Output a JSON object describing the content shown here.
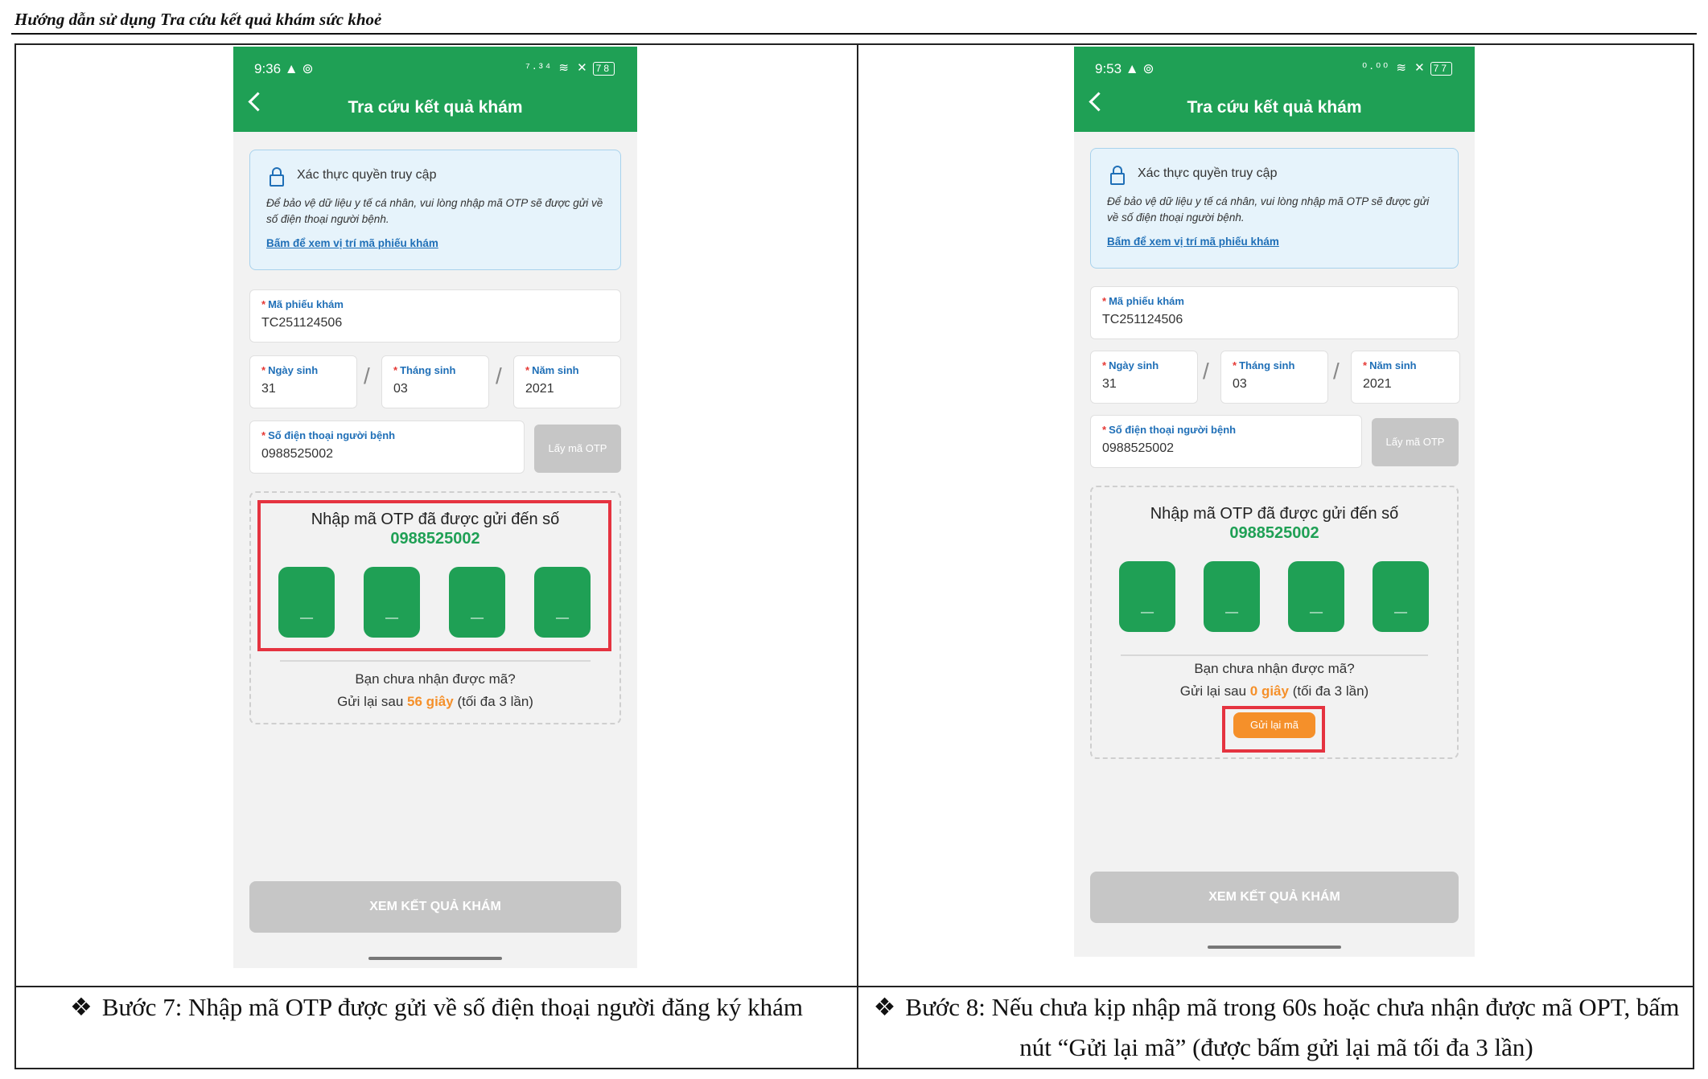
{
  "document": {
    "header_title": "Hướng dẫn sử dụng Tra cứu kết quả khám sức khoẻ"
  },
  "steps": [
    {
      "caption": "Bước 7:  Nhập mã OTP được gửi về số điện thoại người đăng ký khám",
      "bullet": "❖",
      "screen": {
        "status_time": "9:36 ▲ ⊚",
        "status_icons": "⁷·³⁴ ≋ ✕",
        "battery": "78",
        "app_title": "Tra cứu kết quả khám",
        "info_title": "Xác thực quyền truy cập",
        "info_desc": "Để bảo vệ dữ liệu y tế cá nhân, vui lòng nhập mã OTP sẽ được gửi về số điện thoại người bệnh.",
        "info_link": "Bấm để xem vị trí mã phiếu khám",
        "ticket_label": "Mã phiếu khám",
        "ticket_value": "TC251124506",
        "day_label": "Ngày sinh",
        "day_value": "31",
        "month_label": "Tháng sinh",
        "month_value": "03",
        "year_label": "Năm sinh",
        "year_value": "2021",
        "slash": "/",
        "phone_label": "Số điện thoại người bệnh",
        "phone_value": "0988525002",
        "otp_button": "Lấy mã OTP",
        "otp_prompt": "Nhập mã OTP đã được gửi đến số",
        "otp_phone": "0988525002",
        "otp_digits": [
          "_",
          "_",
          "_",
          "_"
        ],
        "resend_question": "Bạn chưa nhận được mã?",
        "resend_prefix": "Gửi lại sau",
        "resend_count": "56 giây",
        "resend_suffix": "(tối đa 3 lần)",
        "view_button": "XEM KẾT QUẢ KHÁM"
      }
    },
    {
      "caption": "Bước 8: Nếu chưa kịp nhập mã trong 60s hoặc chưa nhận được mã OPT, bấm nút “Gửi lại mã” (được bấm gửi lại mã tối đa 3 lần)",
      "bullet": "❖",
      "screen": {
        "status_time": "9:53 ▲ ⊚",
        "status_icons": "⁰·⁰⁰ ≋ ✕",
        "battery": "77",
        "app_title": "Tra cứu kết quả khám",
        "info_title": "Xác thực quyền truy cập",
        "info_desc": "Để bảo vệ dữ liệu y tế cá nhân, vui lòng nhập mã OTP sẽ được gửi về số điện thoại người bệnh.",
        "info_link": "Bấm để xem vị trí mã phiếu khám",
        "ticket_label": "Mã phiếu khám",
        "ticket_value": "TC251124506",
        "day_label": "Ngày sinh",
        "day_value": "31",
        "month_label": "Tháng sinh",
        "month_value": "03",
        "year_label": "Năm sinh",
        "year_value": "2021",
        "slash": "/",
        "phone_label": "Số điện thoại người bệnh",
        "phone_value": "0988525002",
        "otp_button": "Lấy mã OTP",
        "otp_prompt": "Nhập mã OTP đã được gửi đến số",
        "otp_phone": "0988525002",
        "otp_digits": [
          "_",
          "_",
          "_",
          "_"
        ],
        "resend_question": "Bạn chưa nhận được mã?",
        "resend_prefix": "Gửi lại sau",
        "resend_count": "0 giây",
        "resend_suffix": "(tối đa 3 lần)",
        "resend_button": "Gửi lại mã",
        "view_button": "XEM KẾT QUẢ KHÁM"
      }
    }
  ],
  "colors": {
    "brand_green": "#1fa055",
    "link_blue": "#1f6fb7",
    "countdown_orange": "#f5902a",
    "highlight_red": "#e53340",
    "disabled_gray": "#c6c6c6"
  }
}
